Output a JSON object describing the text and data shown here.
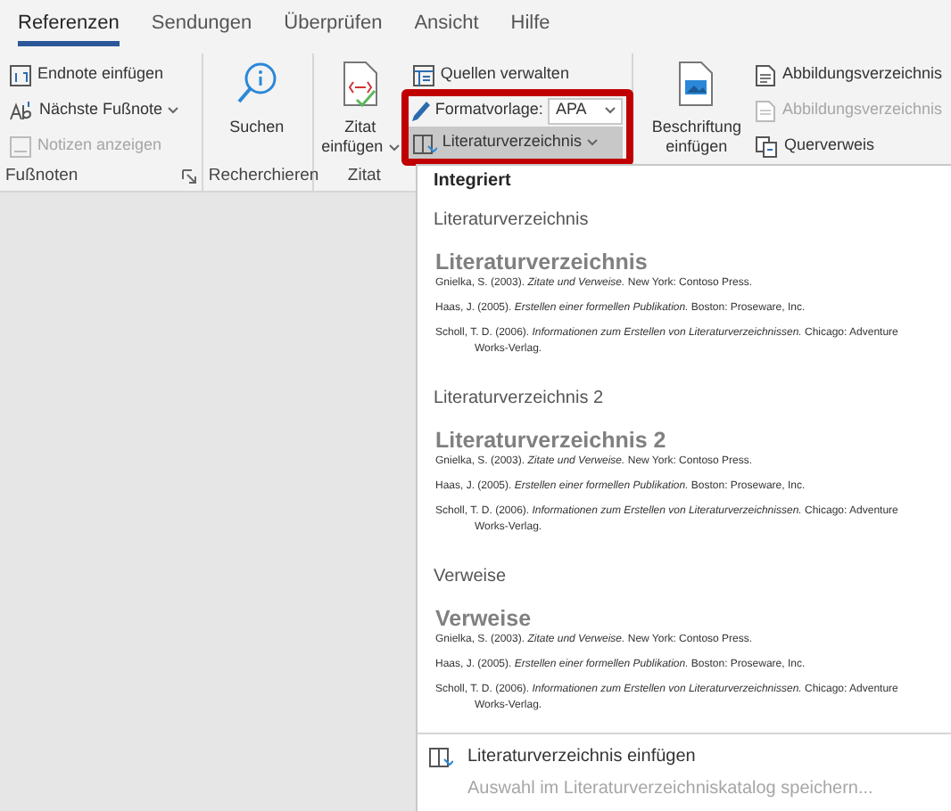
{
  "tabs": [
    {
      "label": "Referenzen",
      "selected": true
    },
    {
      "label": "Sendungen",
      "selected": false
    },
    {
      "label": "Überprüfen",
      "selected": false
    },
    {
      "label": "Ansicht",
      "selected": false
    },
    {
      "label": "Hilfe",
      "selected": false
    }
  ],
  "ribbon": {
    "groups": [
      {
        "label": "Fußnoten",
        "launcher": true,
        "controls": [
          {
            "kind": "small",
            "label": "Endnote einfügen",
            "disabled": false
          },
          {
            "kind": "small",
            "label": "Nächste Fußnote",
            "disabled": false,
            "dropdown": true
          },
          {
            "kind": "small",
            "label": "Notizen anzeigen",
            "disabled": true
          }
        ]
      },
      {
        "label": "Recherchieren",
        "controls": [
          {
            "kind": "large",
            "label": "Suchen",
            "disabled": false
          }
        ]
      },
      {
        "label": "Zitat",
        "controls": [
          {
            "kind": "large",
            "label": "Zitat einfügen",
            "disabled": false,
            "dropdown": true
          },
          {
            "kind": "small",
            "label": "Quellen verwalten",
            "disabled": false
          },
          {
            "kind": "combo",
            "label": "Formatvorlage:",
            "value": "APA",
            "framed": true
          },
          {
            "kind": "small",
            "label": "Literaturverzeichnis",
            "disabled": false,
            "dropdown": true,
            "open": true,
            "framed": true
          }
        ]
      },
      {
        "controls": [
          {
            "kind": "large",
            "label": "Beschriftung einfügen",
            "disabled": false
          },
          {
            "kind": "small",
            "label": "Abbildungsverzeichnis",
            "disabled": false
          },
          {
            "kind": "small",
            "label": "Abbildungsverzeichnis",
            "disabled": true
          },
          {
            "kind": "small",
            "label": "Querverweis",
            "disabled": false
          }
        ]
      }
    ]
  },
  "menu": {
    "items": [
      {
        "kind": "header",
        "label": "Integriert"
      },
      {
        "kind": "gallery",
        "label": "Literaturverzeichnis",
        "preview": {
          "title": "Literaturverzeichnis",
          "entries": [
            "Gnielka, S. (2003). *Zitate und Verweise.* New York: Contoso Press.",
            "Haas, J. (2005). *Erstellen einer formellen Publikation.* Boston: Proseware, Inc.",
            "Scholl, T. D. (2006). *Informationen zum Erstellen von Literaturverzeichnissen.* Chicago: Adventure Works-Verlag."
          ]
        }
      },
      {
        "kind": "gallery",
        "label": "Literaturverzeichnis 2",
        "preview": {
          "title": "Literaturverzeichnis 2",
          "entries": [
            "Gnielka, S. (2003). *Zitate und Verweise.* New York: Contoso Press.",
            "Haas, J. (2005). *Erstellen einer formellen Publikation.* Boston: Proseware, Inc.",
            "Scholl, T. D. (2006). *Informationen zum Erstellen von Literaturverzeichnissen.* Chicago: Adventure Works-Verlag."
          ]
        }
      },
      {
        "kind": "gallery",
        "label": "Verweise",
        "preview": {
          "title": "Verweise",
          "entries": [
            "Gnielka, S. (2003). *Zitate und Verweise.* New York: Contoso Press.",
            "Haas, J. (2005). *Erstellen einer formellen Publikation.* Boston: Proseware, Inc.",
            "Scholl, T. D. (2006). *Informationen zum Erstellen von Literaturverzeichnissen.* Chicago: Adventure Works-Verlag."
          ]
        }
      },
      {
        "kind": "icon_command",
        "label": "Literaturverzeichnis einfügen",
        "disabled": false
      },
      {
        "kind": "command",
        "label": "Auswahl im Literaturverzeichniskatalog speichern...",
        "disabled": true
      }
    ]
  }
}
